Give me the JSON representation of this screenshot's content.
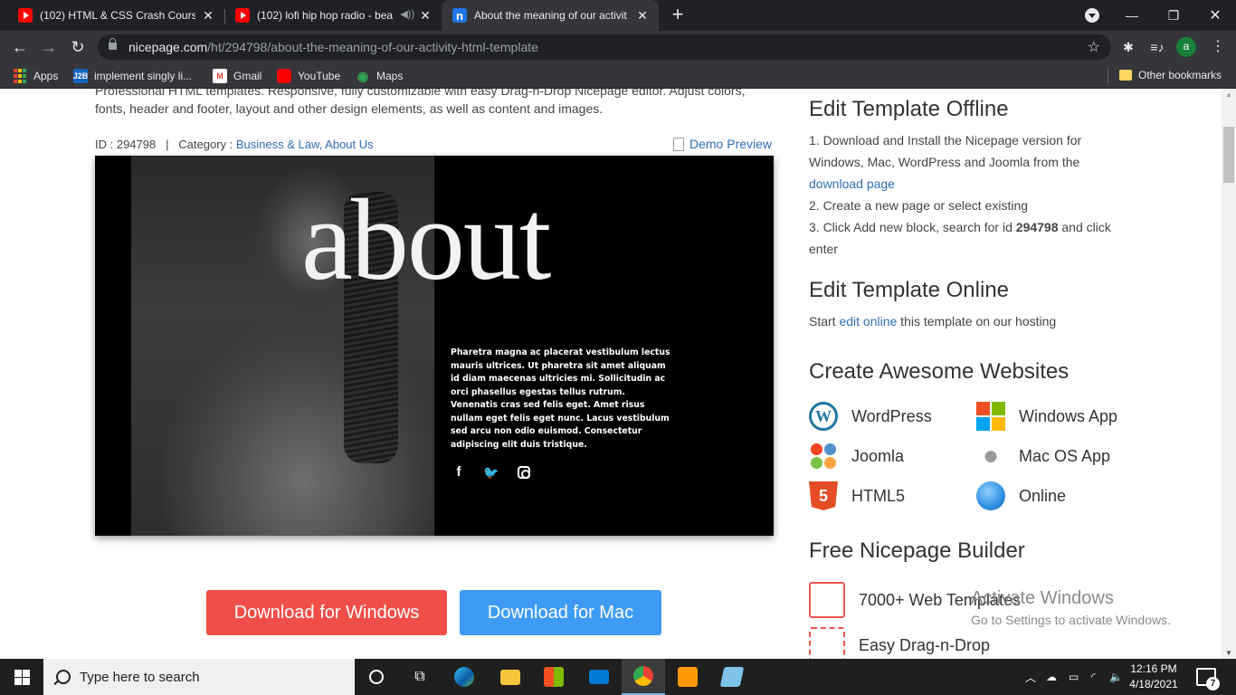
{
  "browser": {
    "tabs": [
      {
        "title": "(102) HTML & CSS Crash Course",
        "favicon": "youtube-icon",
        "active": false
      },
      {
        "title": "(102) lofi hip hop radio - bea",
        "favicon": "youtube-icon",
        "active": false,
        "audio": "speaker-icon"
      },
      {
        "title": "About the meaning of our activit",
        "favicon": "nicepage-icon",
        "active": true
      }
    ],
    "new_tab": "+",
    "url_host": "nicepage.com",
    "url_path": "/ht/294798/about-the-meaning-of-our-activity-html-template",
    "profile_initial": "a",
    "bookmarks": [
      {
        "label": "Apps",
        "icon": "apps-grid-icon"
      },
      {
        "label": "implement singly li...",
        "icon": "j2b-icon",
        "icon_text": "J2B"
      },
      {
        "label": "Gmail",
        "icon": "gmail-icon"
      },
      {
        "label": "YouTube",
        "icon": "youtube-icon"
      },
      {
        "label": "Maps",
        "icon": "maps-icon"
      }
    ],
    "other_bookmarks": "Other bookmarks"
  },
  "page": {
    "description": "Professional HTML templates. Responsive, fully customizable with easy Drag-n-Drop Nicepage editor. Adjust colors, fonts, header and footer, layout and other design elements, as well as content and images.",
    "id_label": "ID : 294798",
    "separator": "|",
    "category_label": "Category : ",
    "category_links": "Business & Law, About Us",
    "demo_preview": "Demo Preview",
    "preview": {
      "heading": "about",
      "paragraph": "Pharetra magna ac placerat vestibulum lectus mauris ultrices. Ut pharetra sit amet aliquam id diam maecenas ultricies mi. Sollicitudin ac orci phasellus egestas tellus rutrum. Venenatis cras sed felis eget. Amet risus nullam eget felis eget nunc. Lacus vestibulum sed arcu non odio euismod. Consectetur adipiscing elit duis tristique.",
      "social": [
        "facebook-icon",
        "twitter-icon",
        "instagram-icon"
      ]
    },
    "download_windows": "Download for Windows",
    "download_mac": "Download for Mac"
  },
  "sidebar": {
    "offline": {
      "title": "Edit Template Offline",
      "step1_a": "1. Download and Install the Nicepage version for Windows, Mac, WordPress and Joomla from the",
      "step1_link": "download page",
      "step2": "2. Create a new page or select existing",
      "step3_a": "3. Click Add new block, search for id ",
      "step3_id": "294798",
      "step3_b": " and click enter"
    },
    "online": {
      "title": "Edit Template Online",
      "text_a": "Start ",
      "link": "edit online",
      "text_b": " this template on our hosting"
    },
    "websites": {
      "title": "Create Awesome Websites",
      "items": [
        "WordPress",
        "Windows App",
        "Joomla",
        "Mac OS App",
        "HTML5",
        "Online"
      ]
    },
    "builder": {
      "title": "Free Nicepage Builder",
      "items": [
        "7000+ Web Templates",
        "Easy Drag-n-Drop"
      ]
    }
  },
  "watermark": {
    "line1": "Activate Windows",
    "line2": "Go to Settings to activate Windows."
  },
  "taskbar": {
    "search_placeholder": "Type here to search",
    "time": "12:16 PM",
    "date": "4/18/2021",
    "notification_count": "7"
  },
  "colors": {
    "link": "#2f6db5",
    "download_windows": "#ef4f48",
    "download_mac": "#3e9bf4",
    "chrome_dark": "#202124",
    "chrome_toolbar": "#35363a"
  }
}
